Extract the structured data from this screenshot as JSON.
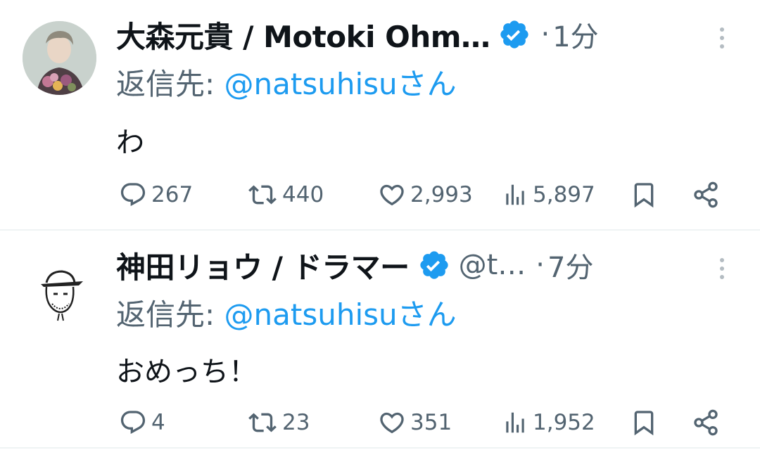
{
  "tweets": [
    {
      "name": "大森元貴 / Motoki Ohm…",
      "handle": "",
      "dot": "·",
      "time": "1分",
      "reply_prefix": "返信先: ",
      "reply_to": "@natsuhisu",
      "reply_suffix": "さん",
      "text": "わ",
      "replies": "267",
      "retweets": "440",
      "likes": "2,993",
      "views": "5,897"
    },
    {
      "name": "神田リョウ / ドラマー",
      "handle": "@t…",
      "dot": "·",
      "time": "7分",
      "reply_prefix": "返信先: ",
      "reply_to": "@natsuhisu",
      "reply_suffix": "さん",
      "text": "おめっち！",
      "replies": "4",
      "retweets": "23",
      "likes": "351",
      "views": "1,952"
    }
  ],
  "colors": {
    "text": "#0f1419",
    "secondary": "#536471",
    "accent": "#1d9bf0",
    "divider": "#eff3f4"
  },
  "icons": [
    "verified-badge-icon",
    "more-icon",
    "reply-icon",
    "retweet-icon",
    "like-icon",
    "views-icon",
    "bookmark-icon",
    "share-icon"
  ]
}
